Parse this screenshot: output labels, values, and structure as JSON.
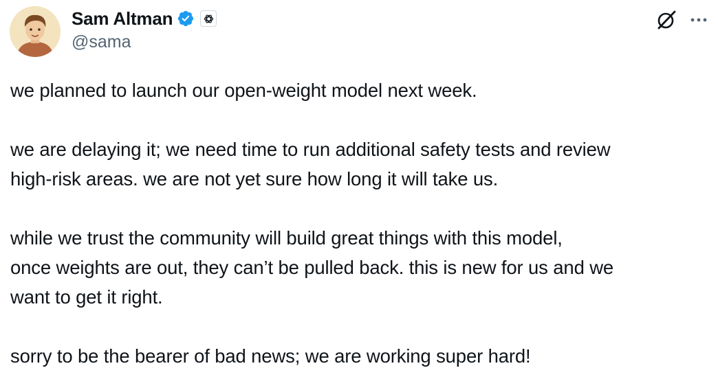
{
  "author": {
    "display_name": "Sam Altman",
    "handle": "@sama",
    "verified": true,
    "affiliate_badge": "openai-logo-icon"
  },
  "icons": {
    "avatar": "avatar",
    "verified": "verified-badge-icon",
    "grok": "grok-icon",
    "more": "more-icon"
  },
  "colors": {
    "verified_blue": "#1d9bf0",
    "text_primary": "#0f1419",
    "text_secondary": "#536471"
  },
  "tweet": {
    "paragraphs": [
      "we planned to launch our open-weight model next week.",
      "we are delaying it; we need time to run additional safety tests and review\nhigh-risk areas. we are not yet sure how long it will take us.",
      "while we trust the community will build great things with this model,\nonce weights are out, they can’t be pulled back. this is new for us and we\nwant to get it right.",
      "sorry to be the bearer of bad news; we are working super hard!"
    ]
  }
}
